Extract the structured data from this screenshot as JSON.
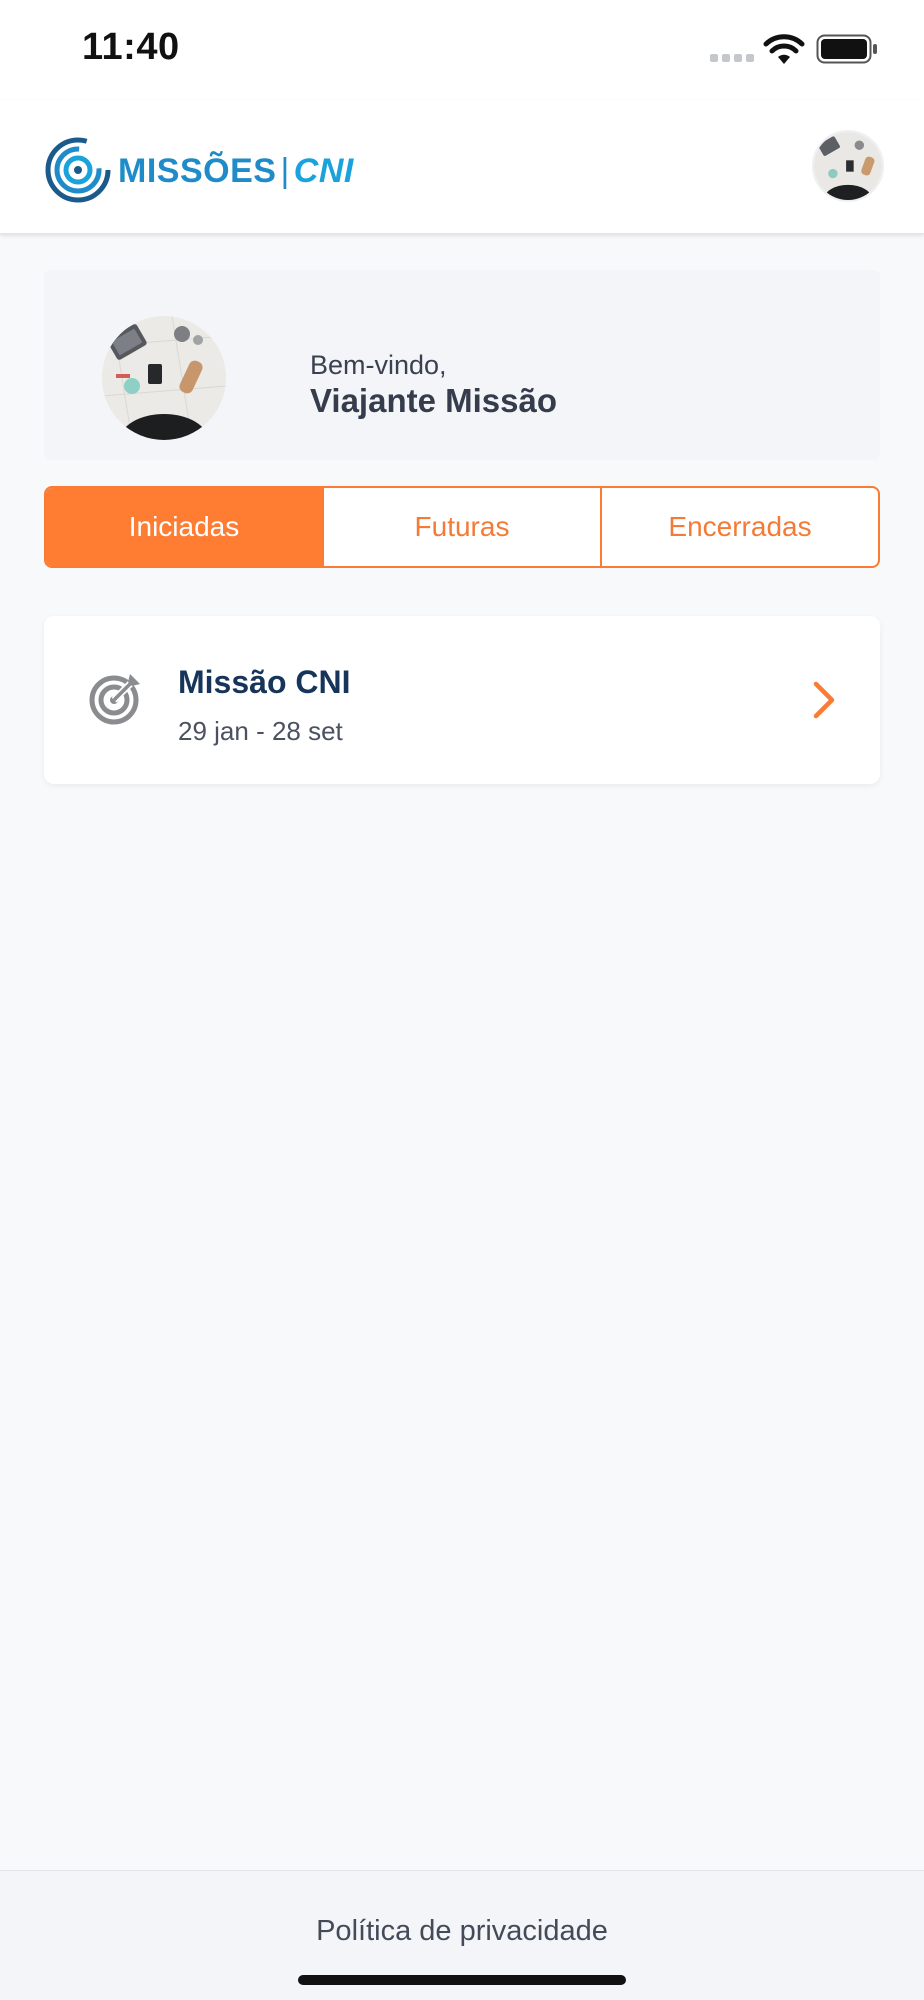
{
  "status_bar": {
    "time": "11:40",
    "icons": [
      "signal-icon",
      "wifi-icon",
      "battery-icon"
    ]
  },
  "header": {
    "logo_text": "MISSÕES",
    "logo_separator": "|",
    "logo_brand": "CNI",
    "avatar_icon": "user-avatar-photo"
  },
  "welcome": {
    "greeting": "Bem-vindo,",
    "name": "Viajante Missão"
  },
  "tabs": [
    {
      "label": "Iniciadas",
      "active": true
    },
    {
      "label": "Futuras",
      "active": false
    },
    {
      "label": "Encerradas",
      "active": false
    }
  ],
  "missions": [
    {
      "title": "Missão CNI",
      "dates": "29 jan - 28 set",
      "icon": "target-icon"
    }
  ],
  "footer": {
    "privacy_link": "Política de privacidade"
  },
  "colors": {
    "accent": "#fe7d32",
    "brand_blue": "#1f8bc8",
    "title_navy": "#17345a"
  }
}
